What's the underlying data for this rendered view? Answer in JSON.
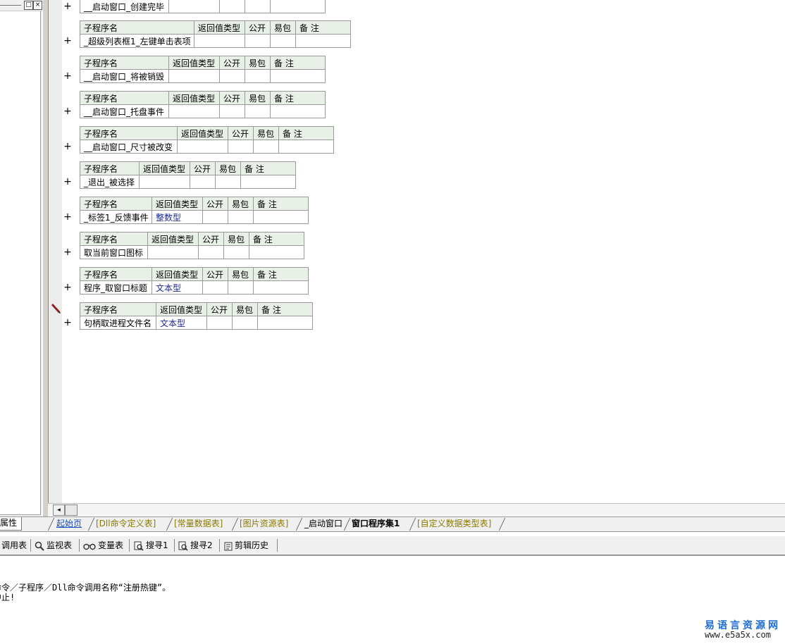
{
  "left_panel": {
    "minimize_glyph": "□",
    "close_glyph": "×"
  },
  "subroutines": [
    {
      "name": "__启动窗口_创建完毕",
      "return_type": ""
    },
    {
      "name": "_超级列表框1_左键单击表项",
      "return_type": ""
    },
    {
      "name": "__启动窗口_将被销毁",
      "return_type": ""
    },
    {
      "name": "__启动窗口_托盘事件",
      "return_type": ""
    },
    {
      "name": "__启动窗口_尺寸被改变",
      "return_type": ""
    },
    {
      "name": "_退出_被选择",
      "return_type": ""
    },
    {
      "name": "_标签1_反馈事件",
      "return_type": "整数型"
    },
    {
      "name": "取当前窗口图标",
      "return_type": ""
    },
    {
      "name": "程序_取窗口标题",
      "return_type": "文本型"
    },
    {
      "name": "句柄取进程文件名",
      "return_type": "文本型"
    }
  ],
  "table_headers": {
    "name": "子程序名",
    "return_type": "返回值类型",
    "public": "公开",
    "easy_pack": "易包",
    "note": "备 注"
  },
  "expand_glyph": "+",
  "scroll_left_glyph": "◂",
  "tabs": {
    "properties": "属性",
    "items": [
      {
        "label": "起始页",
        "style": "link"
      },
      {
        "label": "[Dll命令定义表]",
        "style": "yellow"
      },
      {
        "label": "[常量数据表]",
        "style": "yellow"
      },
      {
        "label": "[图片资源表]",
        "style": "yellow"
      },
      {
        "label": "_启动窗口",
        "style": "normal"
      },
      {
        "label": "窗口程序集1",
        "style": "active"
      },
      {
        "label": "[自定义数据类型表]",
        "style": "yellow"
      }
    ]
  },
  "toolbar": {
    "call_table": "调用表",
    "watch_table": "监视表",
    "var_table": "变量表",
    "search1": "搜寻1",
    "search2": "搜寻2",
    "clip_history": "剪辑历史"
  },
  "output": {
    "line1": "命令／子程序／Dll命令调用名称“注册热键”。",
    "line2": "中止!"
  },
  "watermark": {
    "cn": "易语言资源网",
    "url": "www.e5a5x.com"
  },
  "colors": {
    "header_bg": "#e9f0e8",
    "type_text": "#1c2a8c",
    "tab_link": "#1a4fbf",
    "tab_yellow": "#8a7a00",
    "watermark": "#1f6bd6"
  }
}
